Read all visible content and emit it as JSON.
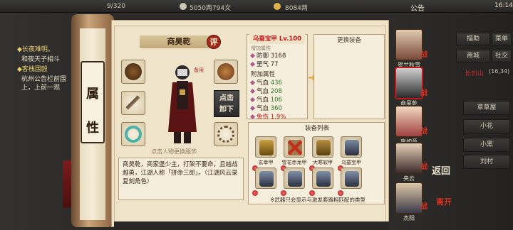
{
  "topbar": {
    "bag_count": "9/320",
    "copper": "5050两794文",
    "gold": "8084两",
    "notice": "公告",
    "time": "16:14"
  },
  "quests": [
    {
      "title": "◆长夜难明。",
      "desc": "和夜天子相斗"
    },
    {
      "title": "◆客栈围殴",
      "desc": "杭州公告栏前围",
      "desc2": "上，上前一观"
    }
  ],
  "scroll": {
    "char1": "属",
    "char2": "性"
  },
  "character": {
    "name": "商昊乾",
    "eval_badge": "评",
    "spare_label": "备用",
    "click_unequip": [
      "点击",
      "卸下"
    ],
    "change_hint": "点击人物更换服饰",
    "description": "商昊乾，商家堡少主，打架不要命，且越战越勇，江湖人称「拼命三郎」。（江湖风云录复刻角色）"
  },
  "attributes": {
    "item_name": "乌蚕宝甲 Lv.100",
    "item_sub": "增加属性",
    "base": [
      {
        "label": "防御",
        "value": "3168"
      },
      {
        "label": "罡气",
        "value": "77"
      }
    ],
    "extra_title": "附加属性",
    "extra": [
      {
        "label": "气血",
        "value": "436"
      },
      {
        "label": "气血",
        "value": "208"
      },
      {
        "label": "气血",
        "value": "106"
      },
      {
        "label": "气血",
        "value": "360"
      },
      {
        "label": "免伤",
        "value": "1.9%"
      }
    ]
  },
  "replace_panel": {
    "title": "更换装备"
  },
  "equip_list": {
    "title": "装备列表",
    "items": [
      {
        "name": "玄幸甲",
        "icon": "gold-armor-icon"
      },
      {
        "name": "雪花赤龙甲",
        "icon": "red-x-armor-icon"
      },
      {
        "name": "大寒软甲",
        "icon": "gold-armor-icon"
      },
      {
        "name": "乌蚕宝甲",
        "icon": "blue-armor-icon"
      },
      {
        "name": "",
        "icon": "blue-armor-icon"
      },
      {
        "name": "",
        "icon": "blue-armor-icon"
      },
      {
        "name": "",
        "icon": "blue-armor-icon"
      },
      {
        "name": "",
        "icon": "blue-armor-icon"
      }
    ],
    "note": "※武器只会显示与激发套路相匹配的类型"
  },
  "party": [
    {
      "name": "贺兰秋雪"
    },
    {
      "name": "商昊乾"
    },
    {
      "name": "南如意"
    },
    {
      "name": "央云"
    },
    {
      "name": "杰阳"
    }
  ],
  "right_menu": {
    "buttons": [
      "描助",
      "菜单",
      "商城",
      "社交"
    ],
    "location": "长白山",
    "coords": "(16,34)",
    "sub_buttons": [
      "草草屋",
      "小花",
      "小黑",
      "刘村"
    ]
  },
  "return": {
    "top": "返回",
    "bottom": "离开"
  },
  "colors": {
    "parchment": "#efe4c9",
    "accent_red": "#c01818",
    "green_value": "#2b7a2b"
  }
}
